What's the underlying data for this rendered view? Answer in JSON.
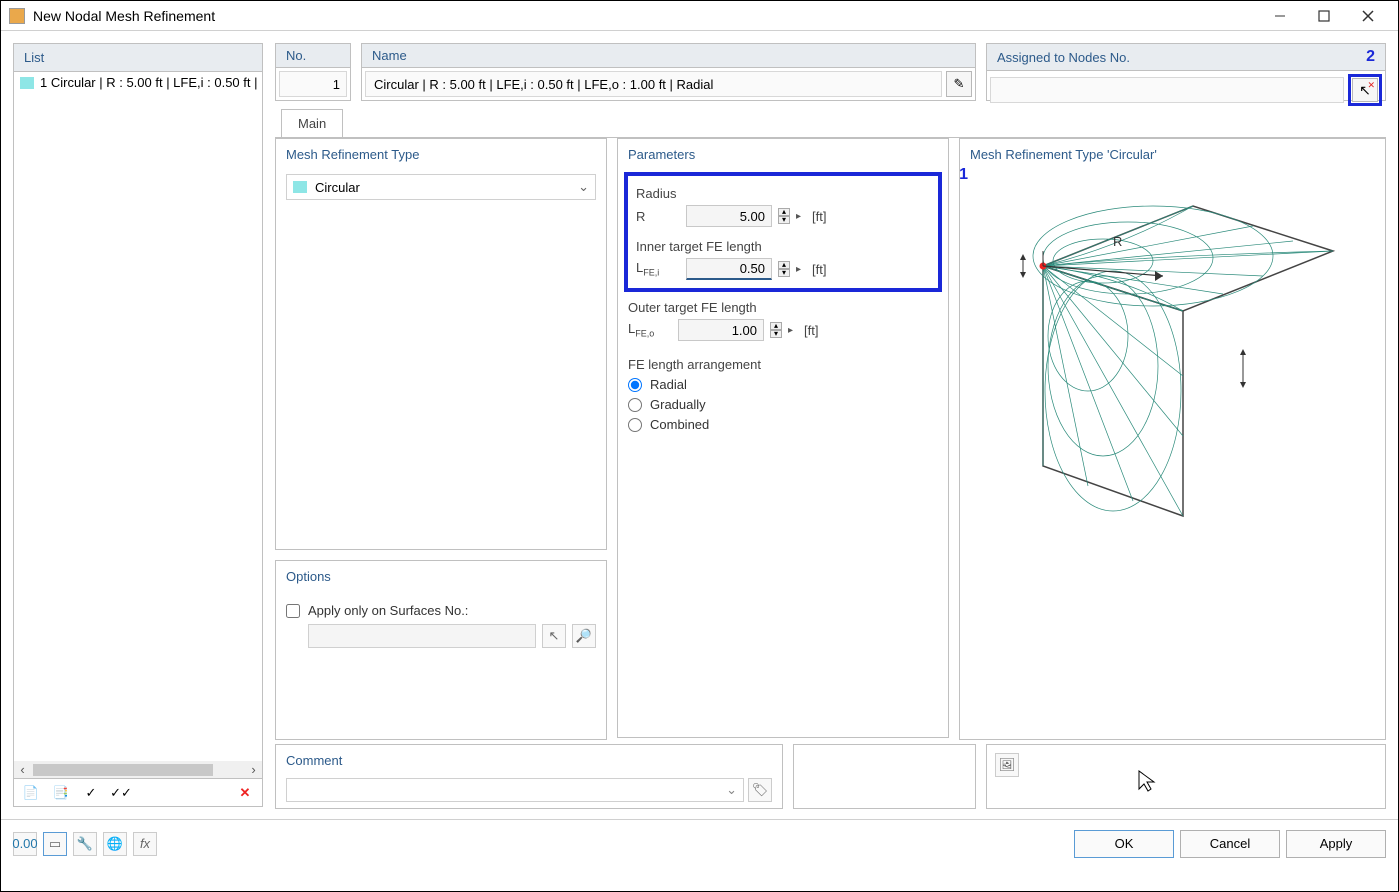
{
  "window": {
    "title": "New Nodal Mesh Refinement"
  },
  "list": {
    "header": "List",
    "items": [
      {
        "text": "1 Circular | R : 5.00 ft | LFE,i : 0.50 ft | L"
      }
    ]
  },
  "no_section": {
    "header": "No.",
    "value": "1"
  },
  "name_section": {
    "header": "Name",
    "value": "Circular | R : 5.00 ft | LFE,i : 0.50 ft | LFE,o : 1.00 ft | Radial"
  },
  "assigned_section": {
    "header": "Assigned to Nodes No.",
    "value": "",
    "callout": "2"
  },
  "tabs": {
    "main": "Main"
  },
  "mesh_type": {
    "header": "Mesh Refinement Type",
    "selected": "Circular"
  },
  "parameters": {
    "header": "Parameters",
    "callout": "1",
    "radius_label": "Radius",
    "radius_sym": "R",
    "radius_value": "5.00",
    "radius_unit": "[ft]",
    "inner_label": "Inner target FE length",
    "inner_sym": "LFE,i",
    "inner_value": "0.50",
    "inner_unit": "[ft]",
    "outer_label": "Outer target FE length",
    "outer_sym": "LFE,o",
    "outer_value": "1.00",
    "outer_unit": "[ft]",
    "arrangement_label": "FE length arrangement",
    "radio_radial": "Radial",
    "radio_gradually": "Gradually",
    "radio_combined": "Combined",
    "selected_arrangement": "Radial"
  },
  "options": {
    "header": "Options",
    "apply_surfaces_label": "Apply only on Surfaces No.:",
    "apply_surfaces_checked": false,
    "surfaces_value": ""
  },
  "preview": {
    "header": "Mesh Refinement Type 'Circular'",
    "radius_label": "R"
  },
  "comment": {
    "header": "Comment",
    "value": ""
  },
  "buttons": {
    "ok": "OK",
    "cancel": "Cancel",
    "apply": "Apply"
  }
}
